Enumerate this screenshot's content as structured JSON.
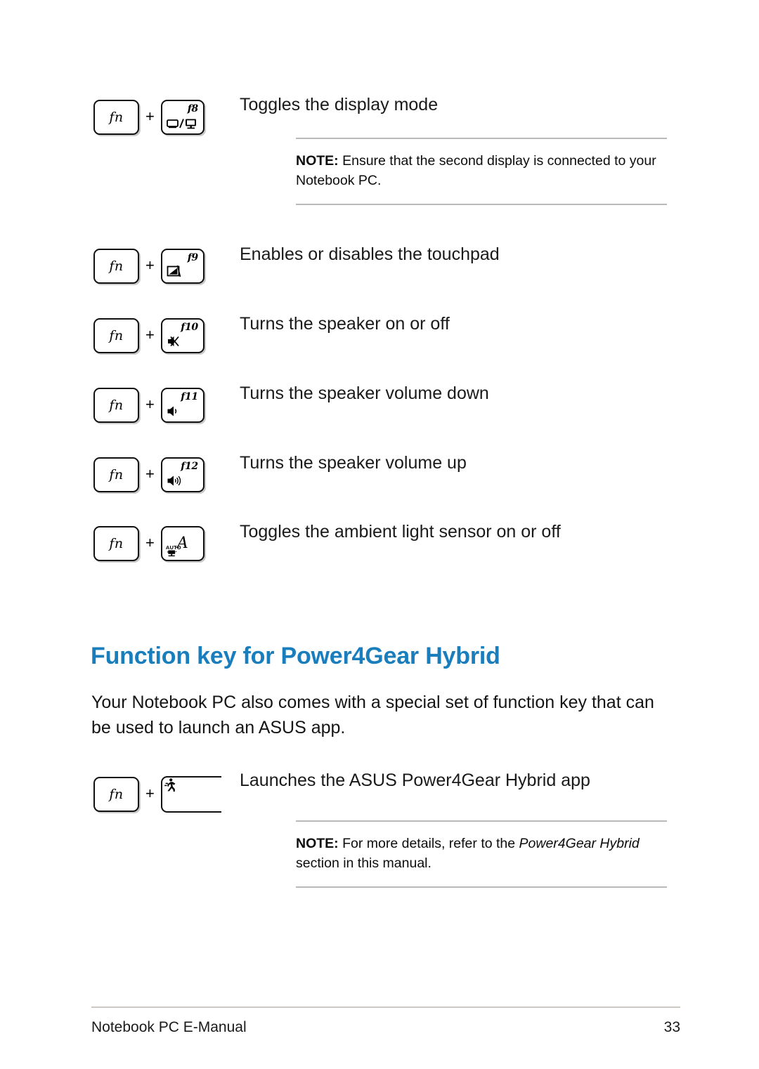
{
  "document": {
    "title": "Notebook PC E-Manual",
    "page_number": "33",
    "heading_color": "#1a7ebd"
  },
  "shortcuts": [
    {
      "modifier": "fn",
      "separator": "+",
      "key_label": "f8",
      "key_icon": "display-switch-icon",
      "description": "Toggles the display mode"
    },
    {
      "modifier": "fn",
      "separator": "+",
      "key_label": "f9",
      "key_icon": "touchpad-disabled-icon",
      "description": "Enables or disables the touchpad"
    },
    {
      "modifier": "fn",
      "separator": "+",
      "key_label": "f10",
      "key_icon": "speaker-mute-icon",
      "description": "Turns the speaker on or off"
    },
    {
      "modifier": "fn",
      "separator": "+",
      "key_label": "f11",
      "key_icon": "volume-down-icon",
      "description": "Turns the speaker volume down"
    },
    {
      "modifier": "fn",
      "separator": "+",
      "key_label": "f12",
      "key_icon": "volume-up-icon",
      "description": "Turns the speaker volume up"
    },
    {
      "modifier": "fn",
      "separator": "+",
      "key_label": "A",
      "key_sublabel": "AUTO",
      "key_icon": "ambient-light-sensor-icon",
      "description": "Toggles the ambient light sensor on or off"
    },
    {
      "modifier": "fn",
      "separator": "+",
      "key_label": "",
      "key_icon": "power4gear-runner-icon",
      "description": "Launches the ASUS Power4Gear Hybrid app"
    }
  ],
  "notes": {
    "display": {
      "label": "NOTE:",
      "text": " Ensure that the second display is connected to your Notebook PC."
    },
    "power4gear": {
      "label": "NOTE:",
      "text_before": " For more details, refer to the ",
      "emphasis": "Power4Gear Hybrid",
      "text_after": " section in this manual."
    }
  },
  "section": {
    "heading": "Function key for Power4Gear Hybrid",
    "body": "Your Notebook PC also comes with a special set of function key that can be used to launch an ASUS app."
  }
}
